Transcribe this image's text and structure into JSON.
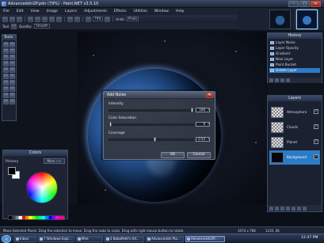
{
  "window": {
    "title": "Advancedshi2P.pdn (79%) - Paint.NET v3.5.10",
    "controls": {
      "minimize": "–",
      "maximize": "□",
      "close": "✕"
    }
  },
  "menu": [
    "File",
    "Edit",
    "View",
    "Image",
    "Layers",
    "Adjustments",
    "Effects",
    "Utilities",
    "Window",
    "Help"
  ],
  "toolbar1": {
    "zoom": "79%",
    "units": "Units:",
    "units_value": "Pixels"
  },
  "toolbar2": {
    "tool_label": "Tool",
    "quality_label": "Quality:",
    "quality_value": "Smooth"
  },
  "tools_window": {
    "title": "Tools"
  },
  "colors_window": {
    "title": "Colors",
    "mode": "Primary",
    "more_button": "More >>"
  },
  "history_window": {
    "title": "History",
    "items": [
      {
        "label": "Layer Noise",
        "selected": false
      },
      {
        "label": "Layer Opacity",
        "selected": false
      },
      {
        "label": "Gradient",
        "selected": false
      },
      {
        "label": "New Layer",
        "selected": false
      },
      {
        "label": "Paint Bucket",
        "selected": false
      },
      {
        "label": "Delete Layer",
        "selected": true
      }
    ]
  },
  "layers_window": {
    "title": "Layers",
    "items": [
      {
        "label": "Atmosphere",
        "selected": false,
        "visible": true
      },
      {
        "label": "Clouds",
        "selected": false,
        "visible": true
      },
      {
        "label": "Planet",
        "selected": false,
        "visible": true
      },
      {
        "label": "Background",
        "selected": true,
        "visible": true
      }
    ]
  },
  "dialog": {
    "title": "Add Noise",
    "close": "✕",
    "params": [
      {
        "label": "Intensity",
        "value": "100",
        "fraction": 1.0
      },
      {
        "label": "Color Saturation",
        "value": "0",
        "fraction": 0.0
      },
      {
        "label": "Coverage",
        "value": "0.54",
        "fraction": 0.54
      }
    ],
    "ok": "OK",
    "cancel": "Cancel"
  },
  "status": {
    "text": "Move Selected Pixels: Drag the selection to move. Drag the nubs to scale. Drag with right mouse button to rotate.",
    "size": "1074 x 768",
    "coords": "1235, 66"
  },
  "taskbar": {
    "items": [
      {
        "label": "Inbox",
        "active": false
      },
      {
        "label": "7 Windows Expl...",
        "active": false
      },
      {
        "label": "Mire",
        "active": false
      },
      {
        "label": "2 BobaPetti's Ult...",
        "active": false
      },
      {
        "label": "Advancedshi Pla...",
        "active": false
      },
      {
        "label": "Advancedshi2P...",
        "active": true
      }
    ],
    "time": "12:47 PM"
  }
}
